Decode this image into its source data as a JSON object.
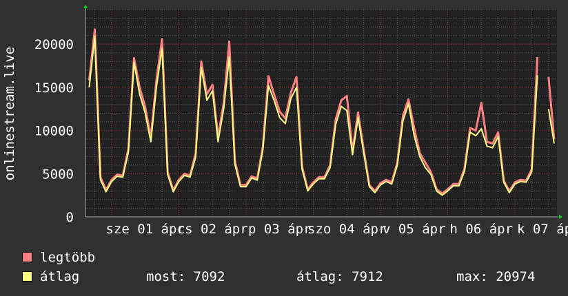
{
  "chart_data": {
    "type": "line",
    "title": "",
    "ylabel": "onlinestream.live",
    "xlabel": "",
    "ylim": [
      0,
      24000
    ],
    "yticks": [
      0,
      5000,
      10000,
      15000,
      20000
    ],
    "grid": true,
    "xlim": [
      "03-31 14:40",
      "04-07 15:00"
    ],
    "xticks": [
      {
        "label": "sze 01 ápr",
        "at": "04-01 12:00"
      },
      {
        "label": "cs 02 ápr",
        "at": "04-02 12:00"
      },
      {
        "label": "p 03 ápr",
        "at": "04-03 12:00"
      },
      {
        "label": "szo 04 ápr",
        "at": "04-04 12:00"
      },
      {
        "label": "v 05 ápr",
        "at": "04-05 12:00"
      },
      {
        "label": "h 06 ápr",
        "at": "04-06 12:00"
      },
      {
        "label": "k 07 ápr",
        "at": "04-07 12:00"
      }
    ],
    "x": [
      "03-31 16:00",
      "03-31 18:00",
      "03-31 20:00",
      "03-31 22:00",
      "04-01 00:00",
      "04-01 02:00",
      "04-01 04:00",
      "04-01 06:00",
      "04-01 08:00",
      "04-01 10:00",
      "04-01 12:00",
      "04-01 14:00",
      "04-01 16:00",
      "04-01 18:00",
      "04-01 20:00",
      "04-01 22:00",
      "04-02 00:00",
      "04-02 02:00",
      "04-02 04:00",
      "04-02 06:00",
      "04-02 08:00",
      "04-02 10:00",
      "04-02 12:00",
      "04-02 14:00",
      "04-02 16:00",
      "04-02 18:00",
      "04-02 20:00",
      "04-02 22:00",
      "04-03 00:00",
      "04-03 02:00",
      "04-03 04:00",
      "04-03 06:00",
      "04-03 08:00",
      "04-03 10:00",
      "04-03 12:00",
      "04-03 14:00",
      "04-03 16:00",
      "04-03 18:00",
      "04-03 20:00",
      "04-03 22:00",
      "04-04 00:00",
      "04-04 02:00",
      "04-04 04:00",
      "04-04 06:00",
      "04-04 08:00",
      "04-04 10:00",
      "04-04 12:00",
      "04-04 14:00",
      "04-04 16:00",
      "04-04 18:00",
      "04-04 20:00",
      "04-04 22:00",
      "04-05 00:00",
      "04-05 02:00",
      "04-05 04:00",
      "04-05 06:00",
      "04-05 08:00",
      "04-05 10:00",
      "04-05 12:00",
      "04-05 14:00",
      "04-05 16:00",
      "04-05 18:00",
      "04-05 20:00",
      "04-05 22:00",
      "04-06 00:00",
      "04-06 02:00",
      "04-06 04:00",
      "04-06 06:00",
      "04-06 08:00",
      "04-06 10:00",
      "04-06 12:00",
      "04-06 14:00",
      "04-06 16:00",
      "04-06 18:00",
      "04-06 20:00",
      "04-06 22:00",
      "04-07 00:00",
      "04-07 02:00",
      "04-07 04:00",
      "04-07 06:00",
      "04-07 08:00",
      "04-07 10:00",
      "04-07 12:00",
      "04-07 14:00"
    ],
    "series": [
      {
        "name": "legtöbb",
        "color": "#ff8080",
        "values": [
          15800,
          21700,
          4600,
          3100,
          4300,
          4900,
          4800,
          7900,
          18400,
          15000,
          12700,
          9200,
          15800,
          20600,
          5200,
          3100,
          4300,
          5000,
          4800,
          7300,
          18000,
          14200,
          15300,
          9200,
          13200,
          20300,
          6500,
          3700,
          3700,
          4700,
          4450,
          8100,
          16300,
          14200,
          12200,
          11400,
          14400,
          16200,
          5800,
          3200,
          4000,
          4600,
          4600,
          6000,
          11300,
          13500,
          14000,
          7600,
          12100,
          7800,
          3700,
          3000,
          3900,
          4300,
          4000,
          6300,
          11700,
          13600,
          10300,
          7400,
          6300,
          5200,
          3200,
          2700,
          3200,
          3800,
          3800,
          5600,
          10300,
          10000,
          13200,
          8700,
          8500,
          9800,
          4200,
          3000,
          4000,
          4300,
          4200,
          5500,
          18500,
          null,
          16200,
          9000
        ]
      },
      {
        "name": "átlag",
        "color": "#ffff80",
        "values": [
          15000,
          20900,
          4300,
          2900,
          4100,
          4700,
          4600,
          7500,
          17900,
          14200,
          12000,
          8700,
          15000,
          19500,
          4900,
          2900,
          4100,
          4800,
          4600,
          6900,
          17300,
          13500,
          14600,
          8700,
          12500,
          18500,
          6100,
          3500,
          3500,
          4500,
          4250,
          7700,
          15200,
          13500,
          11500,
          10800,
          13700,
          15000,
          5500,
          3000,
          3800,
          4400,
          4400,
          5700,
          10700,
          12800,
          12300,
          7200,
          11500,
          7400,
          3500,
          2800,
          3700,
          4100,
          3800,
          6000,
          11100,
          13100,
          9400,
          7000,
          5700,
          4900,
          3000,
          2500,
          3000,
          3600,
          3600,
          5300,
          9800,
          9400,
          10200,
          8200,
          8000,
          9300,
          4000,
          2800,
          3800,
          4100,
          4000,
          5200,
          16400,
          null,
          12500,
          8500
        ]
      }
    ],
    "legend_placement": "bottom-left"
  },
  "legend": {
    "max_label": "legtöbb",
    "avg_label": "átlag",
    "now": "most: 7092",
    "average": "átlag: 7912",
    "maximum": "max: 20974"
  },
  "colors": {
    "background": "#303030",
    "plot_background": "#222222",
    "grid_minor": "#555555",
    "grid_major": "#9a3030",
    "arrow": "#00e000"
  }
}
